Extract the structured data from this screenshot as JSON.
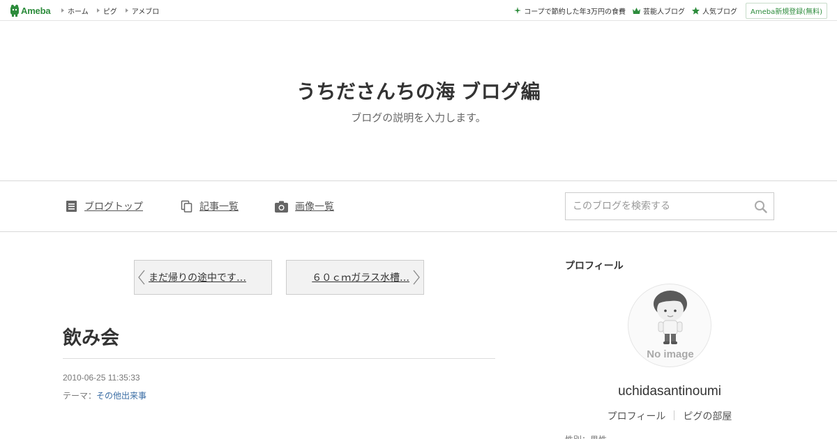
{
  "topbar": {
    "logo_text": "Ameba",
    "links": [
      "ホーム",
      "ピグ",
      "アメブロ"
    ],
    "right_links": [
      "コープで節約した年3万円の食費",
      "芸能人ブログ",
      "人気ブログ"
    ],
    "signup_label": "Ameba新規登録(無料)"
  },
  "header": {
    "title": "うちださんちの海 ブログ編",
    "description": "ブログの説明を入力します。"
  },
  "nav": {
    "items": [
      "ブログトップ",
      "記事一覧",
      "画像一覧"
    ],
    "search_placeholder": "このブログを検索する"
  },
  "pager": {
    "prev_label": "まだ帰りの途中です…",
    "next_label": "６０ｃｍガラス水槽…"
  },
  "entry": {
    "title": "飲み会",
    "date": "2010-06-25 11:35:33",
    "theme_label": "テーマ：",
    "theme_value": "その他出来事"
  },
  "sidebar": {
    "heading": "プロフィール",
    "avatar_text": "No image",
    "username": "uchidasantinoumi",
    "profile_links": [
      "プロフィール",
      "ピグの部屋"
    ],
    "cut_text": "性別：男性"
  },
  "colors": {
    "brand": "#2d8c3c",
    "link": "#3b6ea5",
    "border": "#d9d9d9"
  }
}
